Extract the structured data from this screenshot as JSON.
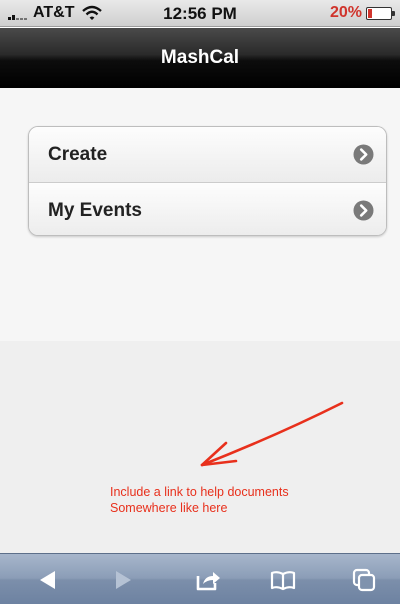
{
  "status_bar": {
    "carrier": "AT&T",
    "time": "12:56 PM",
    "battery_percent": "20%",
    "battery_level": 0.2,
    "signal_icon": "signal-bars-icon",
    "wifi_icon": "wifi-icon"
  },
  "nav": {
    "title": "MashCal"
  },
  "menu": {
    "items": [
      {
        "label": "Create",
        "icon": "chevron-right-icon"
      },
      {
        "label": "My Events",
        "icon": "chevron-right-icon"
      }
    ]
  },
  "annotation": {
    "line1": "Include a link to help documents",
    "line2": "Somewhere like here",
    "color": "#e8301c"
  },
  "toolbar": {
    "buttons": [
      "back-icon",
      "forward-icon",
      "share-icon",
      "bookmarks-icon",
      "pages-icon"
    ]
  }
}
